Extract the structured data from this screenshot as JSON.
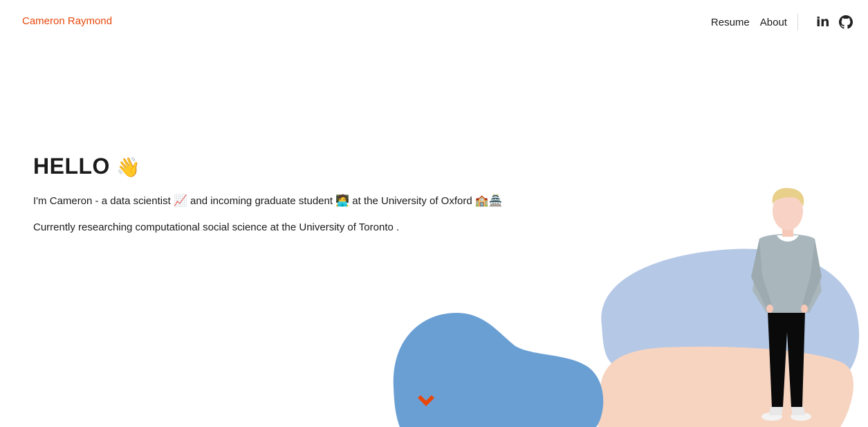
{
  "header": {
    "brand": "Cameron Raymond",
    "nav": [
      {
        "label": "Resume"
      },
      {
        "label": "About"
      }
    ],
    "social": [
      "linkedin-icon",
      "github-icon"
    ],
    "accent_color": "#e8470a"
  },
  "hero": {
    "greeting": "HELLO",
    "greeting_emoji": "👋",
    "intro": {
      "part1": "I'm Cameron - a data scientist",
      "emoji1": "📈",
      "part2": "and incoming graduate student",
      "emoji2": "🧑‍💻",
      "part3": "at the University of Oxford",
      "emoji3": "🏫🏯"
    },
    "research": {
      "text": "Currently researching computational social science at the",
      "link": "University of Toronto",
      "end": "."
    }
  },
  "illustration": {
    "blob_blue": "#6a9fd4",
    "blob_lightblue": "#b5c8e6",
    "blob_peach": "#f6d4c0",
    "scroll_icon": "chevron-down-icon"
  }
}
